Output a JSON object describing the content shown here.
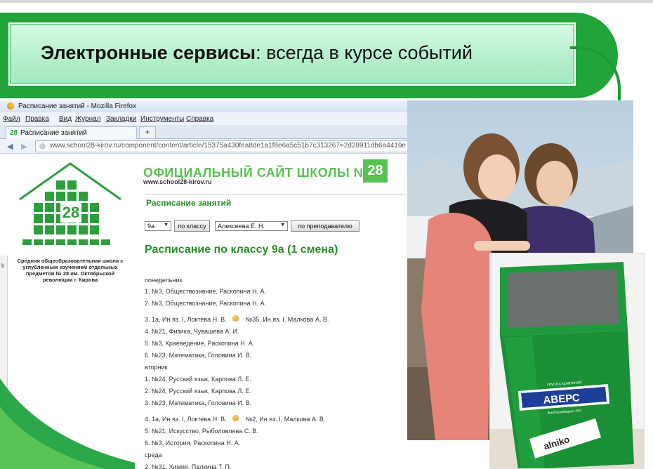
{
  "banner": {
    "title_bold": "Электронные сервисы",
    "title_rest": ": всегда в курсе событий"
  },
  "browser": {
    "window_title": "Расписание занятий - Mozilla Firefox",
    "menu": [
      "Файл",
      "Правка",
      "Вид",
      "Журнал",
      "Закладки",
      "Инструменты",
      "Справка"
    ],
    "tab_number": "28",
    "tab_title": "Расписание занятий",
    "new_tab": "+",
    "url": "www.school28-kirov.ru/component/content/article/15375a430fea8de1a1f8e6a5c51b7c313267=2d28911db6a4419e"
  },
  "site": {
    "logo_number": "28",
    "description": "Средняя общеобразовательная школа с углубленным изучением отдельных предметов № 28 им. Октябрьской революции г. Кирова",
    "title": "ОФИЦИАЛЬНЫЙ САЙТ ШКОЛЫ №",
    "title_number": "28",
    "url": "www.school28-kirov.ru",
    "schedule_heading": "Расписание занятий",
    "class_select": "9а",
    "by_class_button": "по классу",
    "teacher_select": "Алексеева Е. Н.",
    "by_teacher_button": "по преподавателю",
    "class_heading": "Расписание по классу 9а (1 смена)",
    "schedule": [
      {
        "a": "понедельник",
        "b": ""
      },
      {
        "a": "1. №3, Обществознание, Раскопина Н. А.",
        "b": ""
      },
      {
        "a": "2. №3, Обществознание, Раскопина Н. А.",
        "b": ""
      },
      {
        "a": "3. 1а, Ин.яз. I, Локтева Н. В.",
        "b": "№35, Ин.яз. I, Малкова А. В."
      },
      {
        "a": "4. №21, Физика, Чувашева А. И.",
        "b": ""
      },
      {
        "a": "5. №3, Краеведение, Раскопина Н. А.",
        "b": ""
      },
      {
        "a": "6. №23, Математика, Головина И. В.",
        "b": ""
      },
      {
        "a": "вторник",
        "b": ""
      },
      {
        "a": "1. №24, Русский язык, Карпова Л. Е.",
        "b": ""
      },
      {
        "a": "2. №24, Русский язык, Карпова Л. Е.",
        "b": ""
      },
      {
        "a": "3. №23, Математика, Головина И. В.",
        "b": ""
      },
      {
        "a": "4. 1а, Ин.яз. I, Локтева Н. В.",
        "b": "№2, Ин.яз. I, Малкова А. В."
      },
      {
        "a": "5. №21, Искусство, Рыболовлева С. В.",
        "b": ""
      },
      {
        "a": "6. №3, История, Раскопина Н. А.",
        "b": ""
      },
      {
        "a": "среда",
        "b": ""
      },
      {
        "a": "2. №31, Химия, Палкина Т. П.",
        "b": ""
      }
    ]
  },
  "kiosk": {
    "brand": "АВЕРС",
    "brand_caption": "ГРУППА КОМПАНИЙ",
    "brand_sub": "ФинПромМаркет-XXI",
    "sticker": "alniko"
  },
  "colors": {
    "banner_green": "#21a43a",
    "site_green": "#57c251",
    "heading_green": "#2a8d2a",
    "kiosk_green": "#1e9a3c"
  }
}
